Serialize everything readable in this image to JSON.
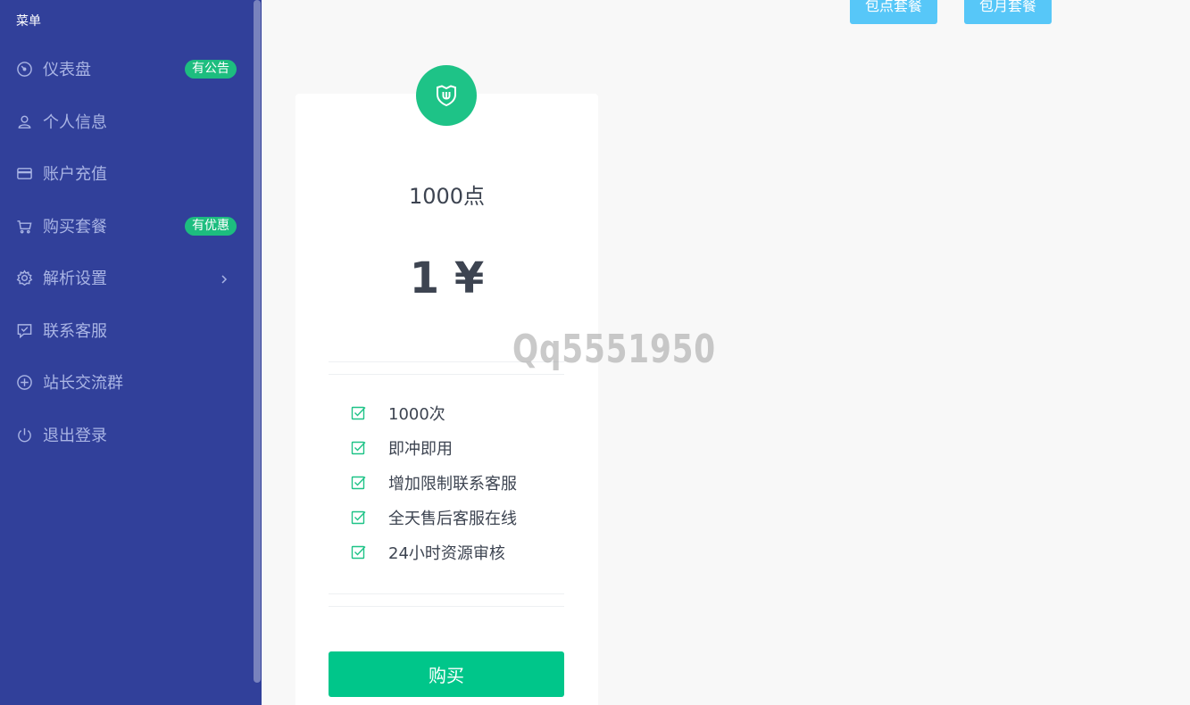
{
  "sidebar": {
    "menu_title": "菜单",
    "items": [
      {
        "label": "仪表盘",
        "icon": "dashboard-icon",
        "badge": "有公告"
      },
      {
        "label": "个人信息",
        "icon": "user-icon"
      },
      {
        "label": "账户充值",
        "icon": "credit-card-icon"
      },
      {
        "label": "购买套餐",
        "icon": "shopping-cart-icon",
        "badge": "有优惠"
      },
      {
        "label": "解析设置",
        "icon": "gear-icon",
        "has_submenu": true
      },
      {
        "label": "联系客服",
        "icon": "chat-icon"
      },
      {
        "label": "站长交流群",
        "icon": "plus-circle-icon"
      },
      {
        "label": "退出登录",
        "icon": "power-icon"
      }
    ]
  },
  "header": {
    "tabs": [
      "包点套餐",
      "包月套餐"
    ]
  },
  "card": {
    "icon": "shield-icon",
    "title": "1000点",
    "price": "1 ¥",
    "features": [
      "1000次",
      "即冲即用",
      "增加限制联系客服",
      "全天售后客服在线",
      "24小时资源审核"
    ],
    "buy_label": "购买"
  },
  "watermark": "Qq5551950",
  "colors": {
    "sidebar_bg": "#31409a",
    "accent_green": "#00c68a",
    "tab_blue": "#57c7f8",
    "badge_green": "#1dbd7f"
  }
}
